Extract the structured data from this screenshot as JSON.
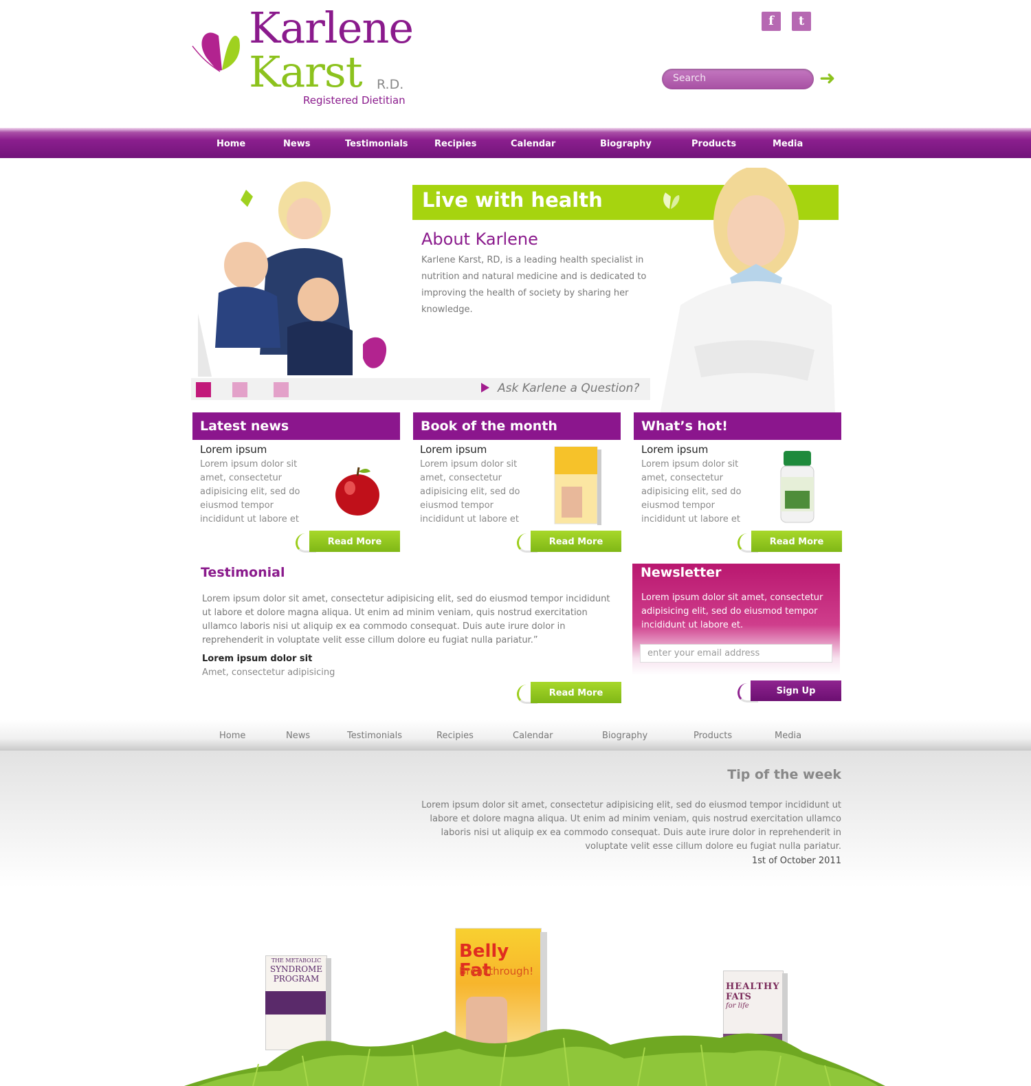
{
  "brand": {
    "name_line1": "Karlene",
    "name_line2": "Karst",
    "credential": "R.D.",
    "subtitle": "Registered Dietitian"
  },
  "social": [
    {
      "label": "f",
      "icon": "facebook-icon"
    },
    {
      "label": "t",
      "icon": "twitter-icon"
    }
  ],
  "search": {
    "placeholder": "Search",
    "icon": "arrow-right-icon"
  },
  "nav": {
    "items": [
      "Home",
      "News",
      "Testimonials",
      "Recipies",
      "Calendar",
      "Biography",
      "Products",
      "Media"
    ]
  },
  "hero": {
    "title": "Live with health",
    "about_title": "About Karlene",
    "about_text": "Karlene Karst, RD, is a leading health specialist in nutrition and natural medicine and is dedicated to improving the health of society by sharing her knowledge.",
    "ask": "Ask Karlene a Question?"
  },
  "boxes": [
    {
      "heading": "Latest news",
      "title": "Lorem ipsum",
      "text": "Lorem ipsum dolor sit amet, consectetur adipisicing elit, sed do eiusmod tempor incididunt ut labore et",
      "button": "Read More",
      "image": "apple"
    },
    {
      "heading": "Book of the month",
      "title": "Lorem ipsum",
      "text": "Lorem ipsum dolor sit amet, consectetur adipisicing elit, sed do eiusmod tempor incididunt ut labore et",
      "button": "Read More",
      "image": "book"
    },
    {
      "heading": "What’s hot!",
      "title": "Lorem ipsum",
      "text": "Lorem ipsum dolor sit amet, consectetur adipisicing elit, sed do eiusmod tempor incididunt ut labore et",
      "button": "Read More",
      "image": "supplement bottle"
    }
  ],
  "testimonial": {
    "title": "Testimonial",
    "text": "Lorem ipsum dolor sit amet, consectetur adipisicing elit, sed do eiusmod tempor incididunt ut labore et dolore magna aliqua. Ut enim ad minim veniam, quis nostrud exercitation ullamco laboris nisi ut aliquip ex ea commodo consequat. Duis aute irure dolor in reprehenderit in voluptate velit esse cillum dolore eu fugiat nulla pariatur.”",
    "name": "Lorem ipsum dolor sit",
    "role": "Amet, consectetur adipisicing",
    "button": "Read More"
  },
  "newsletter": {
    "title": "Newsletter",
    "text": "Lorem ipsum dolor sit amet, consectetur adipisicing elit, sed do eiusmod tempor incididunt ut labore et.",
    "placeholder": "enter your email address",
    "button": "Sign Up"
  },
  "footer_nav": {
    "items": [
      "Home",
      "News",
      "Testimonials",
      "Recipies",
      "Calendar",
      "Biography",
      "Products",
      "Media"
    ]
  },
  "tip": {
    "title": "Tip of the week",
    "text": "Lorem ipsum dolor sit amet, consectetur adipisicing elit, sed do eiusmod tempor incididunt ut labore et dolore magna aliqua. Ut enim ad minim veniam, quis nostrud exercitation ullamco laboris nisi ut aliquip ex ea commodo consequat. Duis aute irure dolor in reprehenderit in voluptate velit esse cillum dolore eu fugiat nulla pariatur.",
    "date": "1st of October 2011"
  },
  "books": [
    {
      "title_line1": "THE METABOLIC",
      "title_line2": "SYNDROME",
      "title_line3": "PROGRAM"
    },
    {
      "title_line1": "Belly Fat",
      "title_line2": "Breakthrough!",
      "title_line3": ""
    },
    {
      "title_line1": "HEALTHY",
      "title_line2": "FATS",
      "title_line3": "for life"
    }
  ],
  "colors": {
    "purple": "#8b168d",
    "green": "#a6d40f",
    "magenta": "#b9176f"
  }
}
